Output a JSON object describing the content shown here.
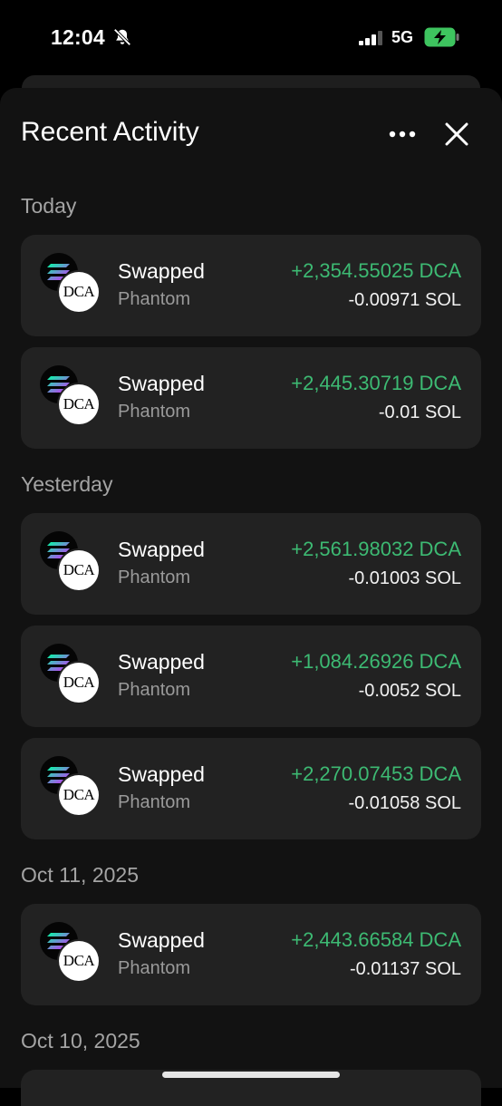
{
  "status": {
    "time": "12:04",
    "network": "5G"
  },
  "header": {
    "title": "Recent Activity"
  },
  "sections": [
    {
      "label": "Today"
    },
    {
      "label": "Yesterday"
    },
    {
      "label": "Oct 11, 2025"
    },
    {
      "label": "Oct 10, 2025"
    }
  ],
  "transactions": [
    {
      "title": "Swapped",
      "source": "Phantom",
      "received": "+2,354.55025 DCA",
      "spent": "-0.00971 SOL",
      "token_badge": "DCA"
    },
    {
      "title": "Swapped",
      "source": "Phantom",
      "received": "+2,445.30719 DCA",
      "spent": "-0.01 SOL",
      "token_badge": "DCA"
    },
    {
      "title": "Swapped",
      "source": "Phantom",
      "received": "+2,561.98032 DCA",
      "spent": "-0.01003 SOL",
      "token_badge": "DCA"
    },
    {
      "title": "Swapped",
      "source": "Phantom",
      "received": "+1,084.26926 DCA",
      "spent": "-0.0052 SOL",
      "token_badge": "DCA"
    },
    {
      "title": "Swapped",
      "source": "Phantom",
      "received": "+2,270.07453 DCA",
      "spent": "-0.01058 SOL",
      "token_badge": "DCA"
    },
    {
      "title": "Swapped",
      "source": "Phantom",
      "received": "+2,443.66584 DCA",
      "spent": "-0.01137 SOL",
      "token_badge": "DCA"
    }
  ],
  "colors": {
    "positive": "#3dba73",
    "sheet": "#121212",
    "row": "#222222"
  },
  "icons": [
    "bell-slash-icon",
    "signal-icon",
    "battery-charging-icon",
    "more-icon",
    "close-icon",
    "solana-icon"
  ]
}
